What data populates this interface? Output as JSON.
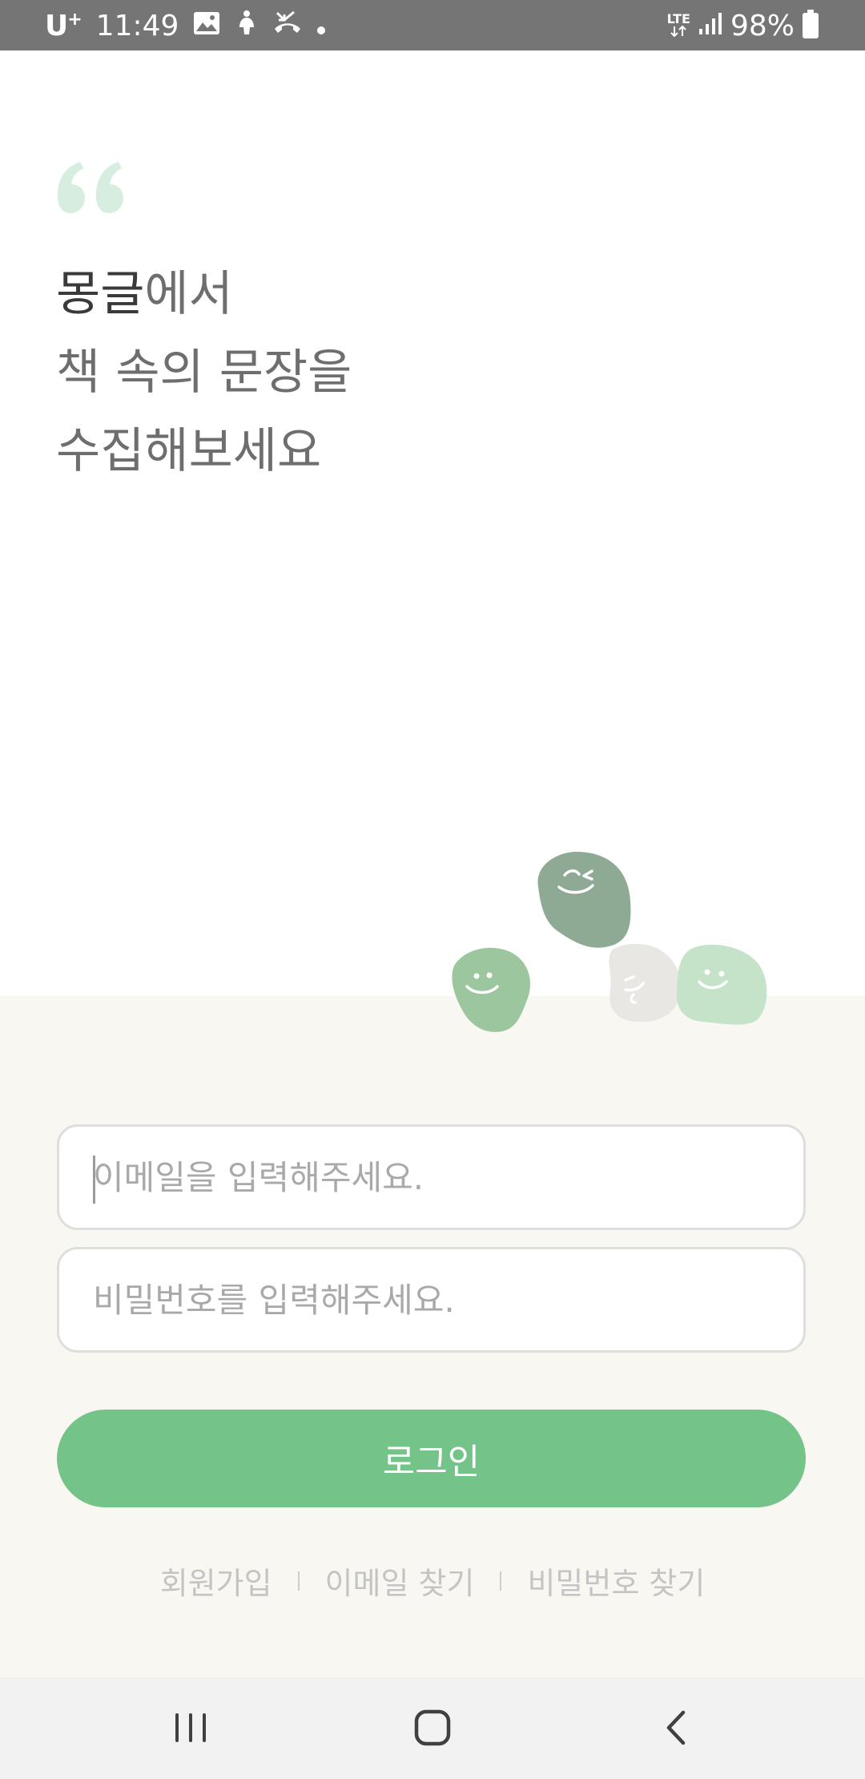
{
  "status_bar": {
    "carrier": "U",
    "carrier_plus": "+",
    "time": "11:49",
    "network": "LTE",
    "battery": "98%"
  },
  "headline": {
    "brand": "몽글",
    "line1_rest": "에서",
    "line2": "책 속의 문장을",
    "line3": "수집해보세요"
  },
  "login_form": {
    "email_placeholder": "이메일을 입력해주세요.",
    "email_value": "",
    "password_placeholder": "비밀번호를 입력해주세요.",
    "password_value": "",
    "login_label": "로그인"
  },
  "links": {
    "signup": "회원가입",
    "find_email": "이메일 찾기",
    "find_password": "비밀번호 찾기"
  },
  "colors": {
    "accent": "#74c388",
    "panel_background": "#f8f7f2",
    "status_bar": "#757575",
    "quote_mark": "#d7ede0"
  },
  "icons": {
    "status_left": [
      "image-icon",
      "accessibility-icon",
      "missed-call-icon",
      "dot-icon"
    ],
    "status_right": [
      "lte-icon",
      "signal-icon",
      "battery-icon"
    ],
    "nav": [
      "recent-apps-icon",
      "home-icon",
      "back-icon"
    ]
  }
}
